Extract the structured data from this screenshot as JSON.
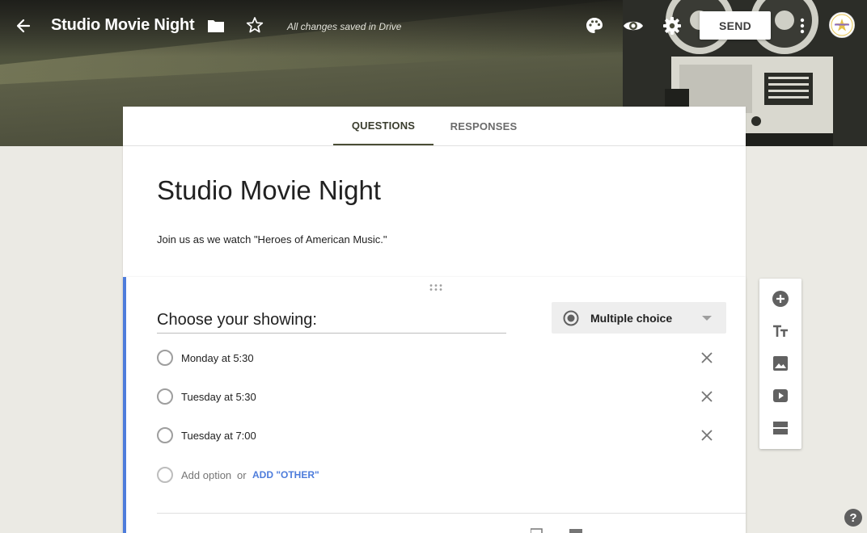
{
  "header": {
    "title": "Studio Movie Night",
    "save_status": "All changes saved in Drive",
    "send_label": "SEND",
    "icons": {
      "back": "arrow-back-icon",
      "folder": "folder-icon",
      "star": "star-outline-icon",
      "palette": "palette-icon",
      "preview": "eye-icon",
      "settings": "gear-icon",
      "more": "more-vert-icon"
    }
  },
  "tabs": [
    {
      "label": "QUESTIONS",
      "active": true
    },
    {
      "label": "RESPONSES",
      "active": false
    }
  ],
  "form": {
    "title": "Studio Movie Night",
    "description": "Join us as we watch \"Heroes of American Music.\""
  },
  "question": {
    "title": "Choose your showing:",
    "type": "Multiple choice",
    "options": [
      {
        "label": "Monday at 5:30"
      },
      {
        "label": "Tuesday at 5:30"
      },
      {
        "label": "Tuesday at 7:00"
      }
    ],
    "add_option": "Add option",
    "or_text": "or",
    "add_other": "ADD \"OTHER\""
  },
  "side_tools": [
    "add-question-icon",
    "title-text-icon",
    "image-icon",
    "video-icon",
    "section-icon"
  ],
  "help_label": "?",
  "colors": {
    "accent": "#4d7cdb",
    "header_dark": "#3d3f33",
    "background": "#ebeae4"
  }
}
